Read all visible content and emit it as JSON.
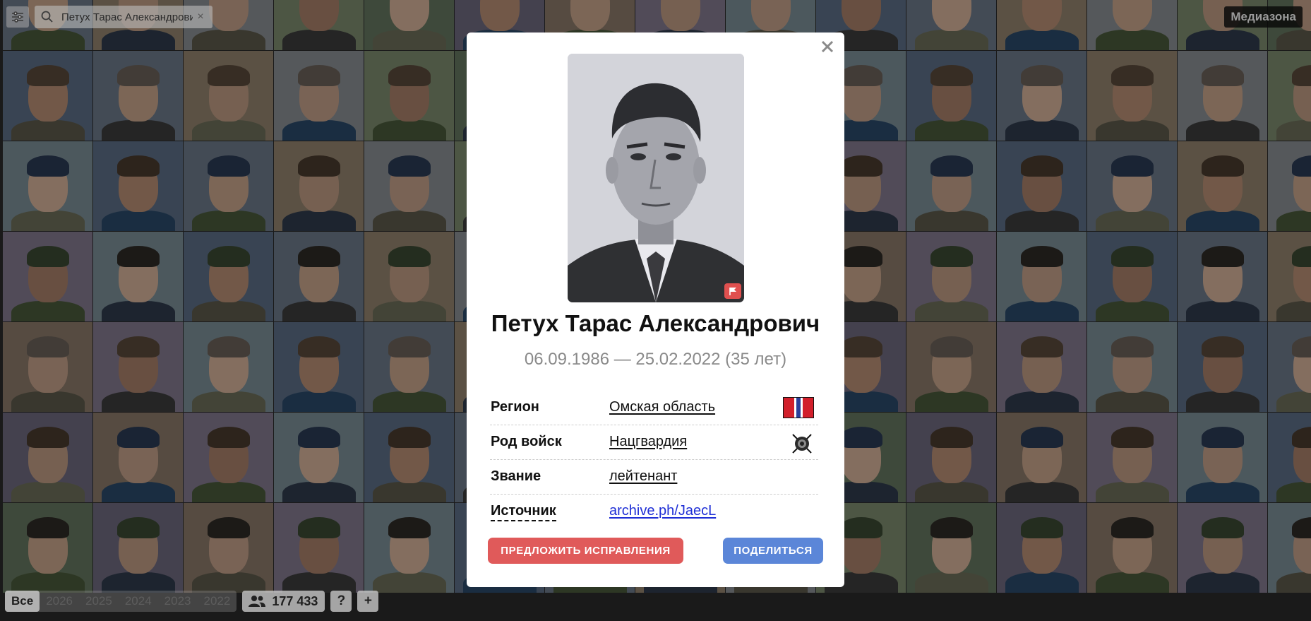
{
  "app": {
    "brand": "Медиазона"
  },
  "search": {
    "value": "Петух Тарас Александрович",
    "placeholder": ""
  },
  "bottom_bar": {
    "years": [
      "Все",
      "2026",
      "2025",
      "2024",
      "2023",
      "2022"
    ],
    "active_year": "Все",
    "count": "177 433",
    "help_label": "?",
    "add_label": "+"
  },
  "modal": {
    "name": "Петух Тарас Александрович",
    "dates": "06.09.1986 — 25.02.2022 (35 лет)",
    "rows": [
      {
        "label": "Регион",
        "value": "Омская область",
        "icon": "region-flag-icon"
      },
      {
        "label": "Род войск",
        "value": "Нацгвардия",
        "icon": "national-guard-emblem-icon"
      },
      {
        "label": "Звание",
        "value": "лейтенант",
        "icon": ""
      },
      {
        "label": "Источник",
        "value": "archive.ph/JaecL",
        "icon": ""
      }
    ],
    "suggest_label": "ПРЕДЛОЖИТЬ ИСПРАВЛЕНИЯ",
    "share_label": "ПОДЕЛИТЬСЯ"
  },
  "colors": {
    "suggest_button": "#e05a5a",
    "share_button": "#5b86d8",
    "link": "#1f2fd6",
    "dates_text": "#8a8a8a",
    "report_flag": "#e0504f"
  }
}
